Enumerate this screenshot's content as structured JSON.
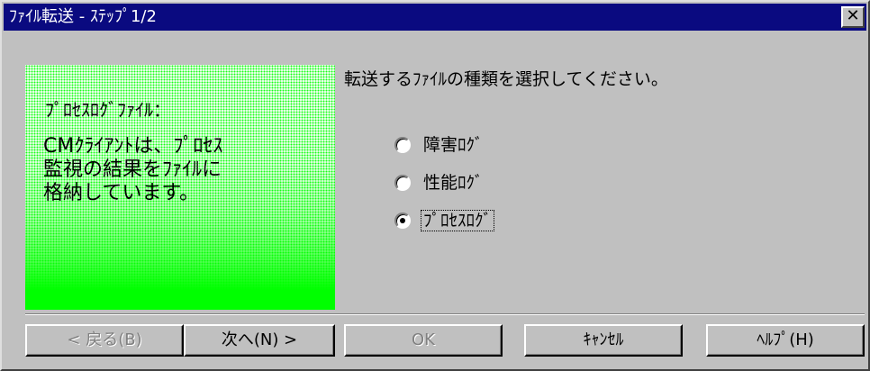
{
  "window": {
    "title": "ﾌｧｲﾙ転送 - ｽﾃｯﾌﾟ1/2",
    "close_label": "✕"
  },
  "side_panel": {
    "heading": "ﾌﾟﾛｾｽﾛｸﾞﾌｧｲﾙ：",
    "body_lines": [
      "CMｸﾗｲｱﾝﾄは、ﾌﾟﾛｾｽ",
      "監視の結果をﾌｧｲﾙに",
      "格納しています。"
    ],
    "colors": {
      "top": "#ffffff",
      "bottom": "#00ff00"
    }
  },
  "instruction": "転送するﾌｧｲﾙの種類を選択してください。",
  "options": [
    {
      "label": "障害ﾛｸﾞ",
      "selected": false
    },
    {
      "label": "性能ﾛｸﾞ",
      "selected": false
    },
    {
      "label": "ﾌﾟﾛｾｽﾛｸﾞ",
      "selected": true
    }
  ],
  "buttons": {
    "back": "< 戻る(B)",
    "next": "次へ(N) >",
    "ok": "OK",
    "cancel": "ｷｬﾝｾﾙ",
    "help": "ﾍﾙﾌﾟ(H)"
  },
  "colors": {
    "titlebar": "#0a0a80",
    "face": "#c0c0c0"
  }
}
